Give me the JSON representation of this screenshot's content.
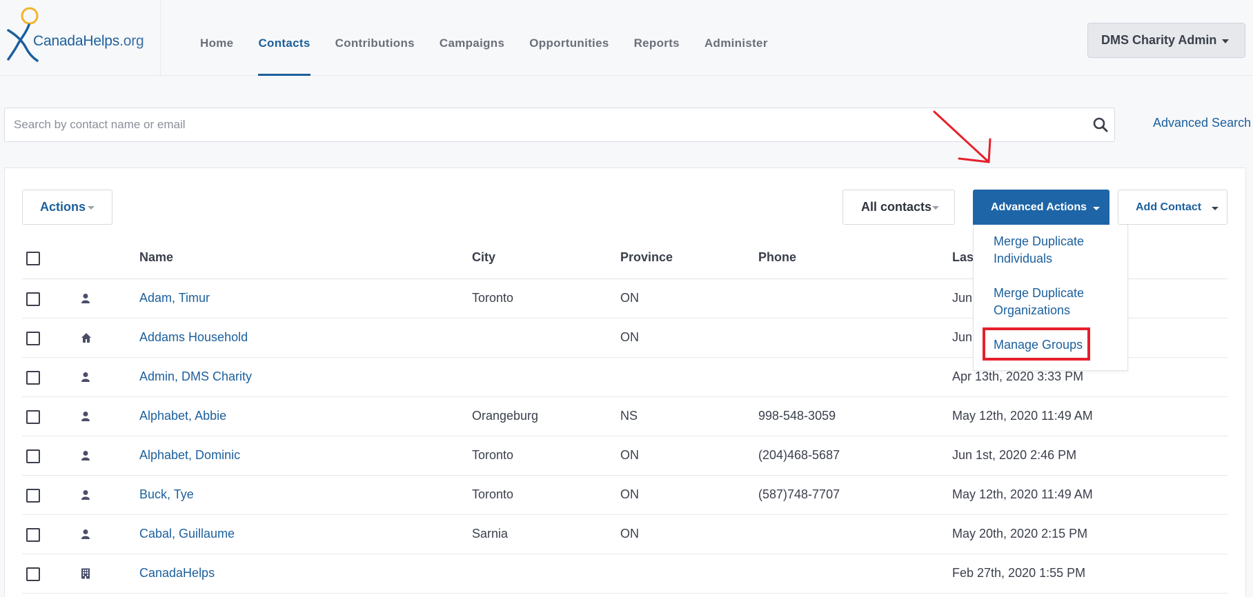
{
  "brand": {
    "name_part1": "Canada",
    "name_part2": "Helps",
    "name_part3": ".org"
  },
  "nav": {
    "items": [
      {
        "label": "Home",
        "active": false
      },
      {
        "label": "Contacts",
        "active": true
      },
      {
        "label": "Contributions",
        "active": false
      },
      {
        "label": "Campaigns",
        "active": false
      },
      {
        "label": "Opportunities",
        "active": false
      },
      {
        "label": "Reports",
        "active": false
      },
      {
        "label": "Administer",
        "active": false
      }
    ]
  },
  "user_menu": {
    "label": "DMS Charity Admin"
  },
  "search": {
    "placeholder": "Search by contact name or email",
    "value": "",
    "advanced_link": "Advanced Search"
  },
  "toolbar": {
    "actions_label": "Actions",
    "filter_label": "All contacts",
    "advanced_actions_label": "Advanced Actions",
    "add_contact_label": "Add Contact"
  },
  "advanced_menu": {
    "items": [
      {
        "label": "Merge Duplicate Individuals"
      },
      {
        "label": "Merge Duplicate Organizations"
      },
      {
        "label": "Manage Groups",
        "highlighted": true
      }
    ]
  },
  "table": {
    "headers": {
      "name": "Name",
      "city": "City",
      "province": "Province",
      "phone": "Phone",
      "last": "Last"
    },
    "rows": [
      {
        "type": "person-icon",
        "name": "Adam, Timur",
        "city": "Toronto",
        "province": "ON",
        "phone": "",
        "last": "Jun"
      },
      {
        "type": "home-icon",
        "name": "Addams Household",
        "city": "",
        "province": "ON",
        "phone": "",
        "last": "Jun"
      },
      {
        "type": "person-icon",
        "name": "Admin, DMS Charity",
        "city": "",
        "province": "",
        "phone": "",
        "last": "Apr 13th, 2020 3:33 PM"
      },
      {
        "type": "person-icon",
        "name": "Alphabet, Abbie",
        "city": "Orangeburg",
        "province": "NS",
        "phone": "998-548-3059",
        "last": "May 12th, 2020 11:49 AM"
      },
      {
        "type": "person-icon",
        "name": "Alphabet, Dominic",
        "city": "Toronto",
        "province": "ON",
        "phone": "(204)468-5687",
        "last": "Jun 1st, 2020 2:46 PM"
      },
      {
        "type": "person-icon",
        "name": "Buck, Tye",
        "city": "Toronto",
        "province": "ON",
        "phone": "(587)748-7707",
        "last": "May 12th, 2020 11:49 AM"
      },
      {
        "type": "person-icon",
        "name": "Cabal, Guillaume",
        "city": "Sarnia",
        "province": "ON",
        "phone": "",
        "last": "May 20th, 2020 2:15 PM"
      },
      {
        "type": "building-icon",
        "name": "CanadaHelps",
        "city": "",
        "province": "",
        "phone": "",
        "last": "Feb 27th, 2020 1:55 PM"
      }
    ]
  },
  "colors": {
    "brand_blue": "#1b5f9c",
    "button_blue": "#1d65a6",
    "highlight_red": "#e5202a",
    "logo_yellow": "#f2b32a"
  }
}
